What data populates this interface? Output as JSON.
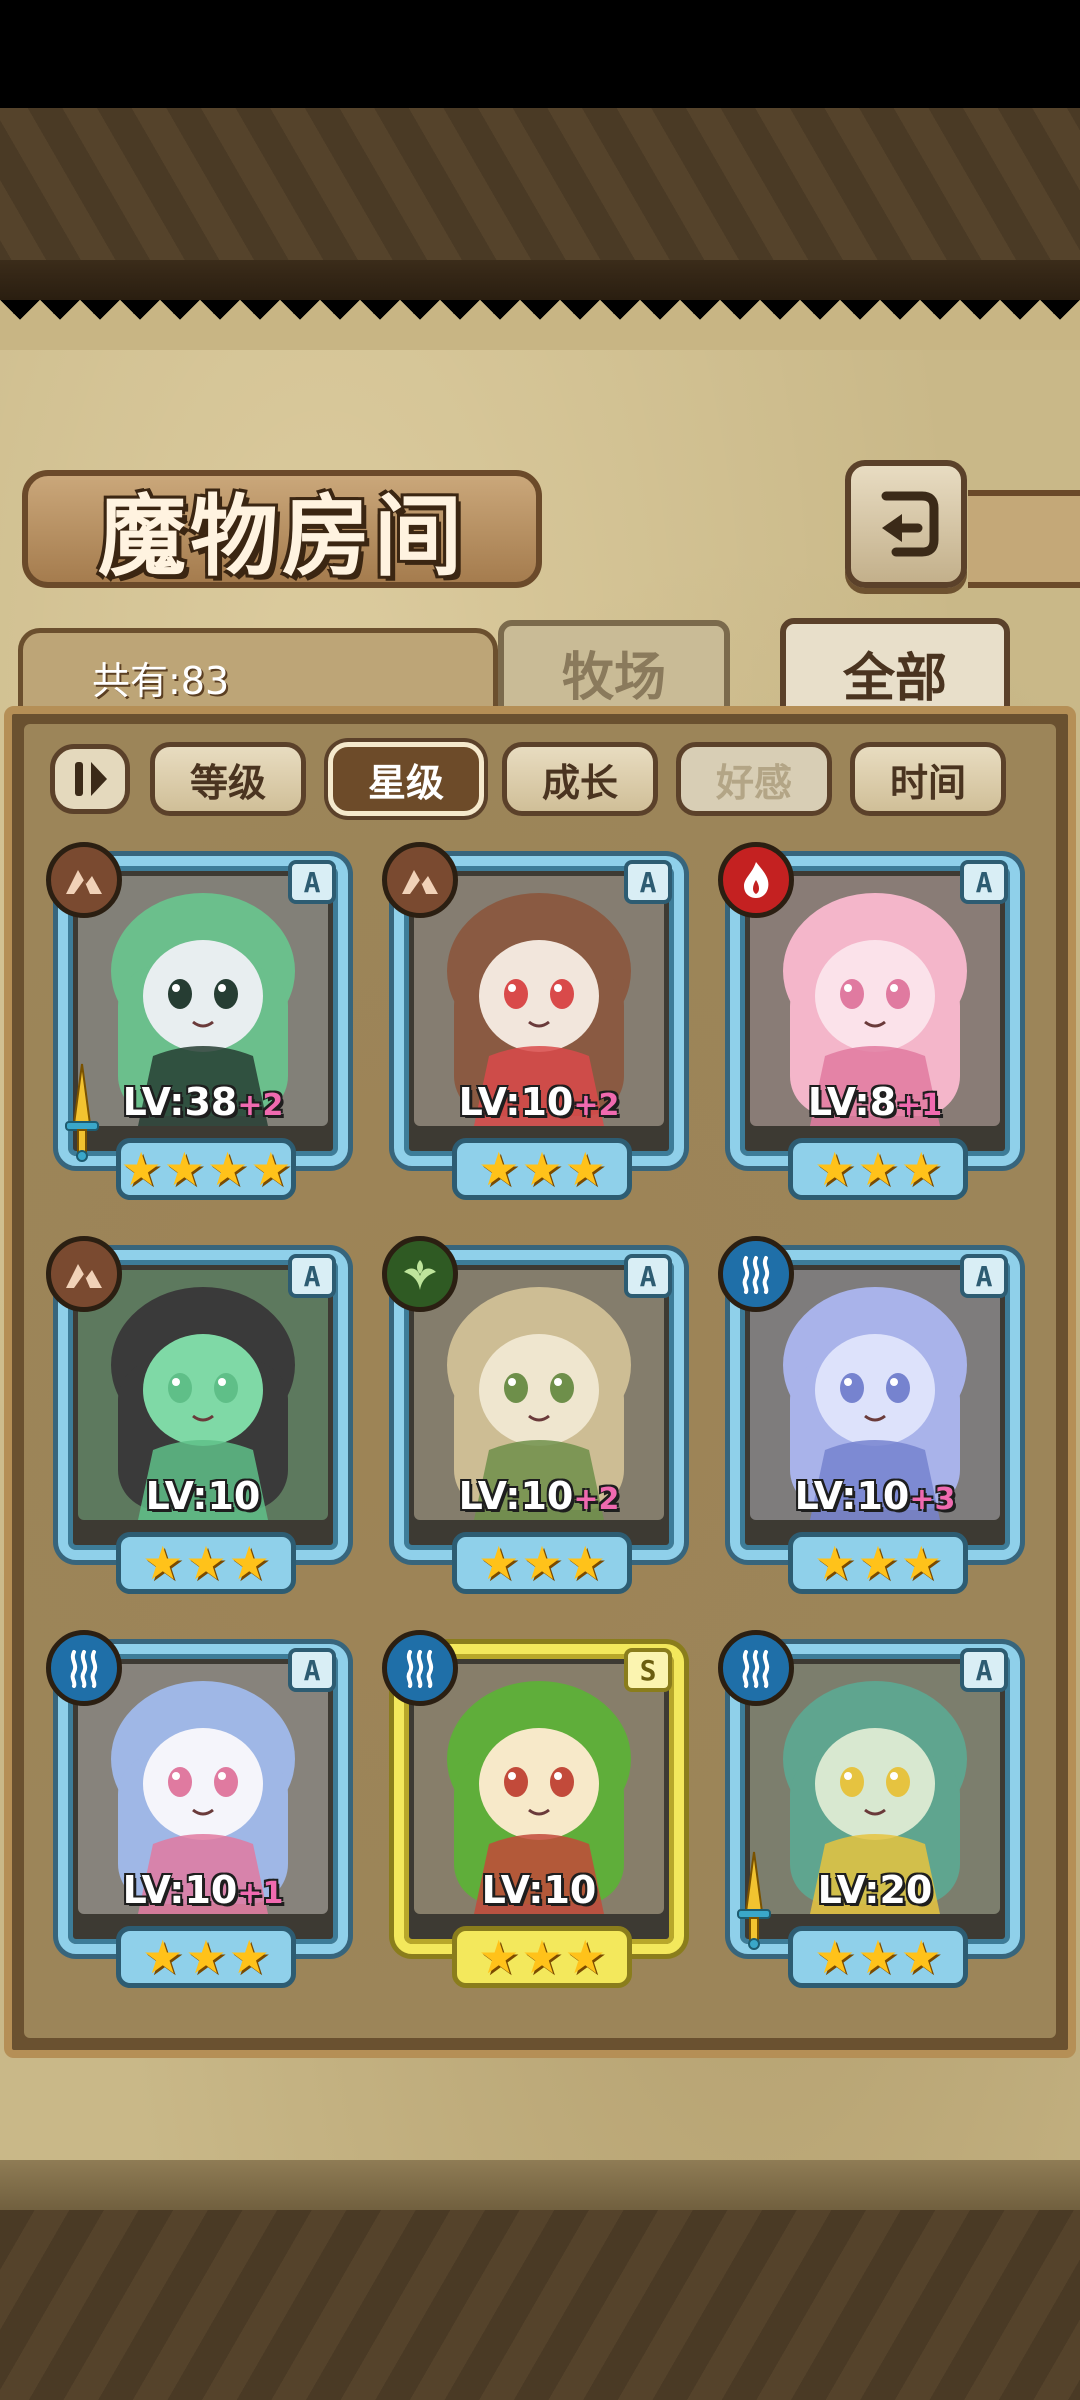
{
  "title": "魔物房间",
  "total_label": "共有:83",
  "tabs": [
    {
      "label": "牧场",
      "active": false
    },
    {
      "label": "全部",
      "active": true
    }
  ],
  "sort_buttons": [
    {
      "label": "等级",
      "state": "normal"
    },
    {
      "label": "星级",
      "state": "active"
    },
    {
      "label": "成长",
      "state": "normal"
    },
    {
      "label": "好感",
      "state": "dim"
    },
    {
      "label": "时间",
      "state": "normal"
    }
  ],
  "cards": [
    {
      "element": "earth-icon",
      "rank": "A",
      "level": "LV:38",
      "bonus": "+2",
      "stars": 4,
      "weapon": true,
      "palette": [
        "#e8eef0",
        "#6bbf8c",
        "#263d33"
      ]
    },
    {
      "element": "earth-icon",
      "rank": "A",
      "level": "LV:10",
      "bonus": "+2",
      "stars": 3,
      "weapon": false,
      "palette": [
        "#f2e6dc",
        "#8a5a42",
        "#d94a4a"
      ]
    },
    {
      "element": "fire-icon",
      "rank": "A",
      "level": "LV:8",
      "bonus": "+1",
      "stars": 3,
      "weapon": false,
      "palette": [
        "#fbe2ea",
        "#f4b6ca",
        "#e07aa0"
      ]
    },
    {
      "element": "earth-icon",
      "rank": "A",
      "level": "LV:10",
      "bonus": "",
      "stars": 3,
      "weapon": false,
      "palette": [
        "#7fd9a6",
        "#3a3a3a",
        "#5fbf88"
      ]
    },
    {
      "element": "leaf-icon",
      "rank": "A",
      "level": "LV:10",
      "bonus": "+2",
      "stars": 3,
      "weapon": false,
      "palette": [
        "#efe6cf",
        "#cdbd94",
        "#6e8f4a"
      ]
    },
    {
      "element": "water-icon",
      "rank": "A",
      "level": "LV:10",
      "bonus": "+3",
      "stars": 3,
      "weapon": false,
      "palette": [
        "#dde2fb",
        "#a9b3ea",
        "#7683cf"
      ]
    },
    {
      "element": "water-icon",
      "rank": "A",
      "level": "LV:10",
      "bonus": "+1",
      "stars": 3,
      "weapon": false,
      "palette": [
        "#f5f5fb",
        "#9fb7e6",
        "#e07aa0"
      ]
    },
    {
      "element": "water-icon",
      "rank": "S",
      "level": "LV:10",
      "bonus": "",
      "stars": 3,
      "weapon": false,
      "gold": true,
      "palette": [
        "#f7e9c9",
        "#5fae3a",
        "#c24a3a"
      ]
    },
    {
      "element": "water-icon",
      "rank": "A",
      "level": "LV:20",
      "bonus": "",
      "stars": 3,
      "weapon": true,
      "palette": [
        "#d8e8d0",
        "#5fa58f",
        "#e6c340"
      ]
    }
  ]
}
